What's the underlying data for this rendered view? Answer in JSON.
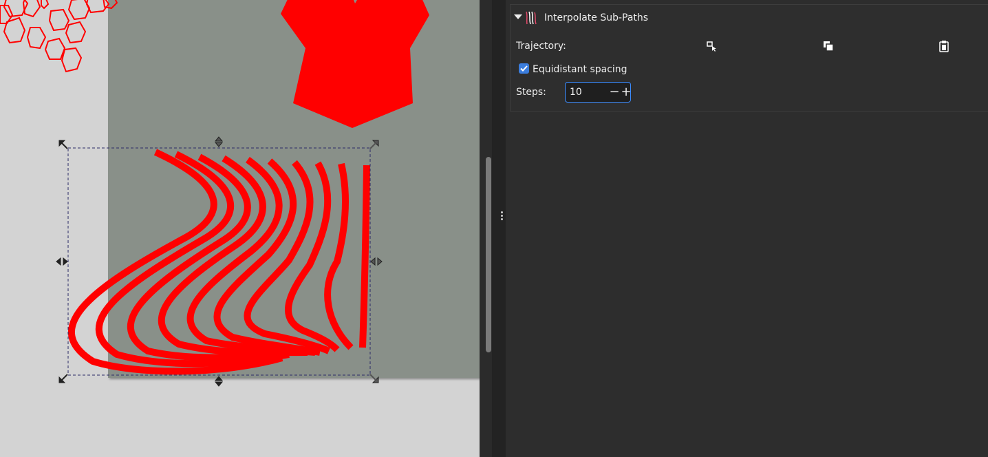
{
  "lpe": {
    "title": "Interpolate Sub-Paths",
    "trajectory_label": "Trajectory:",
    "equidistant_label": "Equidistant spacing",
    "equidistant_checked": true,
    "steps_label": "Steps:",
    "steps_value": "10",
    "decrement_symbol": "−",
    "increment_symbol": "+",
    "trajectory_buttons": [
      "edit-on-canvas-icon",
      "copy-path-icon",
      "paste-path-icon"
    ]
  },
  "colors": {
    "path_red": "#ff0000",
    "page_gray": "#899089",
    "panel_bg": "#2d2d2d",
    "accent_blue": "#3b7ddd"
  }
}
